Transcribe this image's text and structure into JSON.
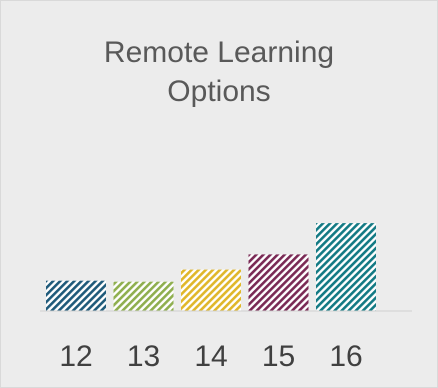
{
  "chart_data": {
    "type": "bar",
    "title": "Remote Learning\nOptions",
    "categories": [
      "12",
      "13",
      "14",
      "15",
      "16"
    ],
    "values": [
      30,
      29,
      41,
      56,
      87
    ],
    "ylim": [
      0,
      100
    ],
    "grid": false,
    "legend": "none",
    "colors": [
      "#1f5a7a",
      "#8faf4f",
      "#e0b72a",
      "#7a2a55",
      "#137a84"
    ],
    "fill_style": "diagonal-hatch"
  }
}
